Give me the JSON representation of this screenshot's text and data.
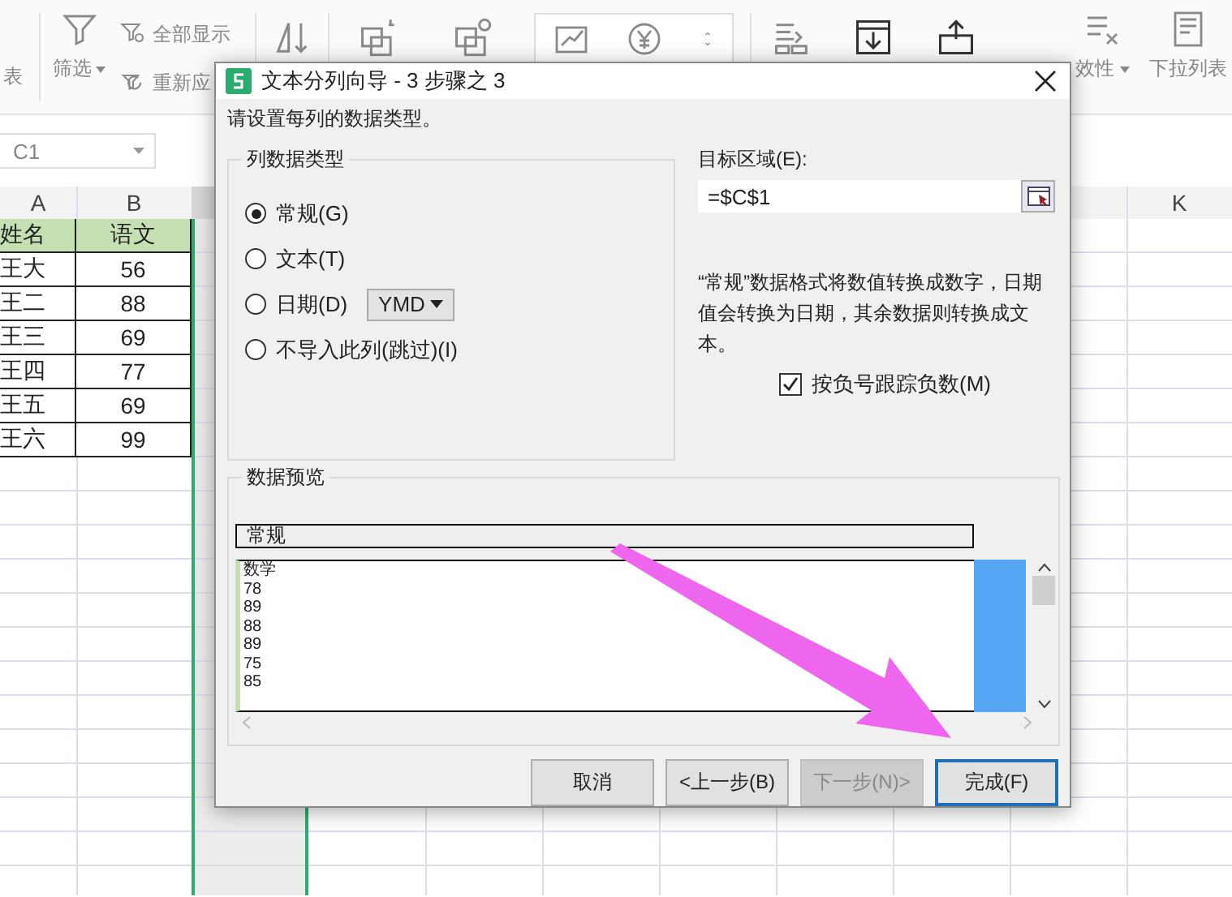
{
  "ribbon": {
    "left_cut": "表",
    "filter": "筛选",
    "show_all": "全部显示",
    "reapply": "重新应",
    "validity": "效性",
    "dropdown_list": "下拉列表"
  },
  "name_box": "C1",
  "columns": [
    {
      "label": "A"
    },
    {
      "label": "B"
    },
    {
      "label": "K"
    }
  ],
  "table": {
    "header": [
      "姓名",
      "语文"
    ],
    "rows": [
      [
        "王大",
        "56"
      ],
      [
        "王二",
        "88"
      ],
      [
        "王三",
        "69"
      ],
      [
        "王四",
        "77"
      ],
      [
        "王五",
        "69"
      ],
      [
        "王六",
        "99"
      ]
    ]
  },
  "dialog": {
    "title": "文本分列向导 - 3 步骤之 3",
    "instruction": "请设置每列的数据类型。",
    "column_type": {
      "title": "列数据类型",
      "options": [
        {
          "label": "常规(G)",
          "selected": true,
          "kind": "plain"
        },
        {
          "label": "文本(T)",
          "selected": false,
          "kind": "plain"
        },
        {
          "label": "日期(D)",
          "selected": false,
          "kind": "date",
          "format": "YMD"
        },
        {
          "label": "不导入此列(跳过)(I)",
          "selected": false,
          "kind": "plain"
        }
      ]
    },
    "target": {
      "label": "目标区域(E):",
      "value": "=$C$1"
    },
    "description": "“常规”数据格式将数值转换成数字，日期值会转换为日期，其余数据则转换成文本。",
    "negative_checkbox": {
      "label": "按负号跟踪负数(M)",
      "checked": true
    },
    "preview": {
      "title": "数据预览",
      "header": "常规",
      "lines": [
        "数学",
        "78",
        "89",
        "88",
        "89",
        "75",
        "85"
      ]
    },
    "buttons": [
      {
        "label": "取消",
        "kind": "normal"
      },
      {
        "label": "<上一步(B)",
        "kind": "normal"
      },
      {
        "label": "下一步(N)>",
        "kind": "disabled"
      },
      {
        "label": "完成(F)",
        "kind": "default"
      }
    ]
  }
}
